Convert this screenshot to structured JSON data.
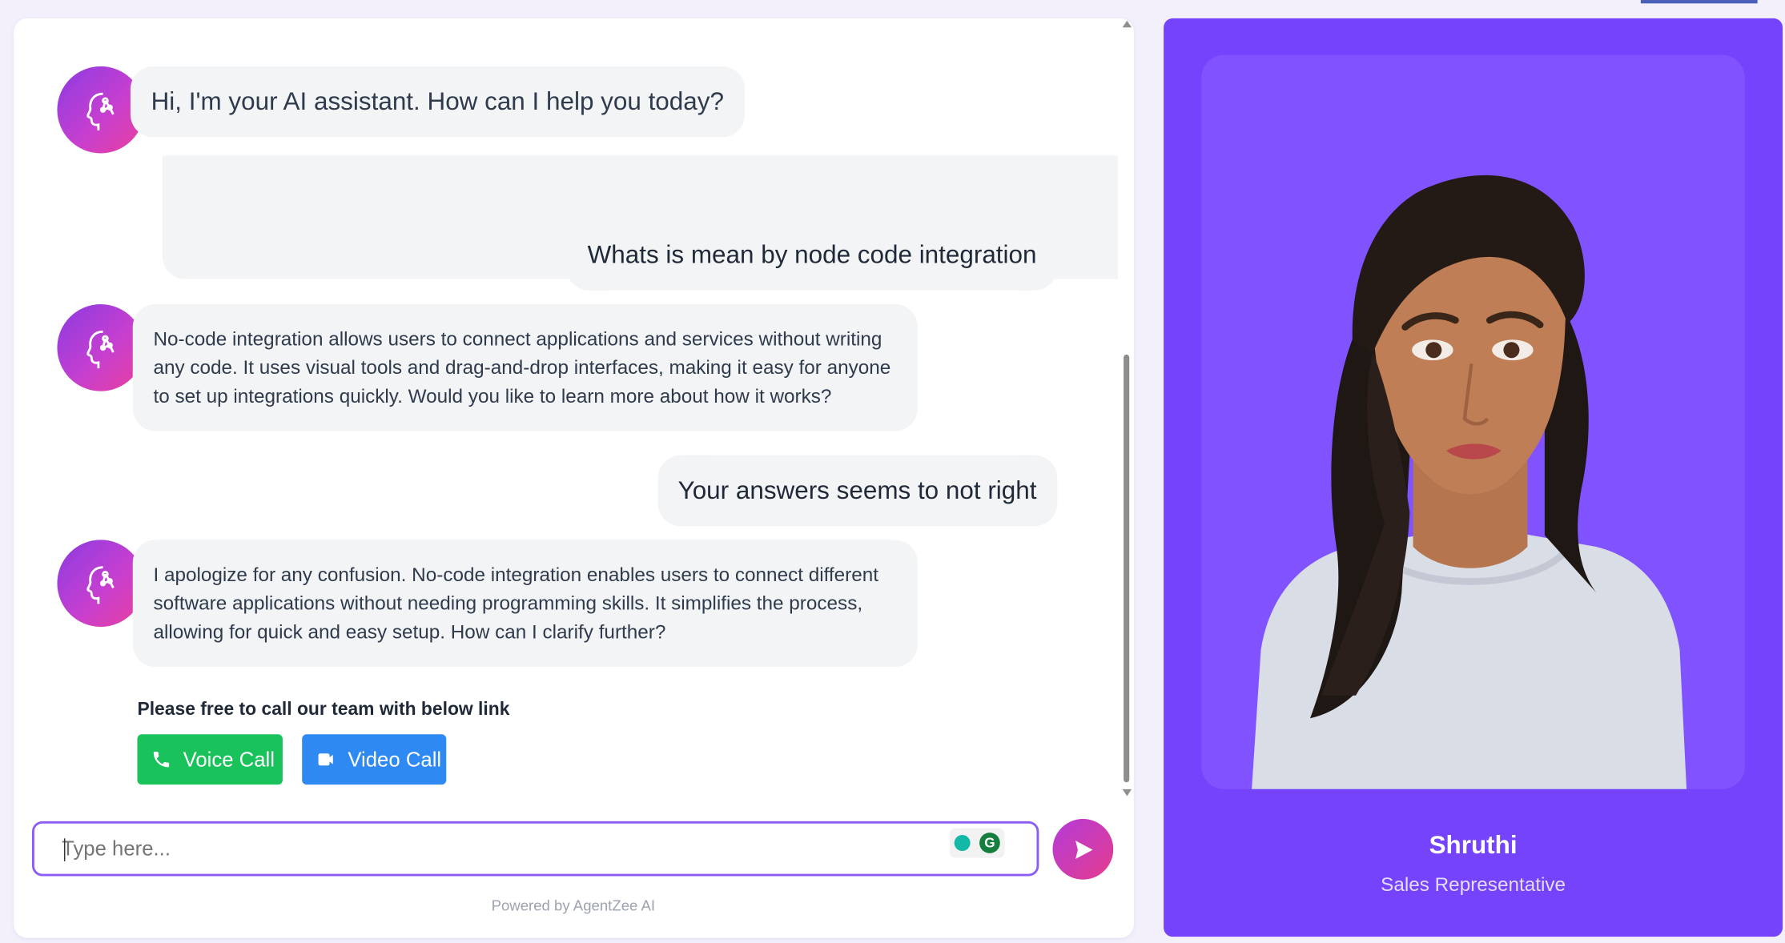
{
  "chat": {
    "messages": [
      {
        "role": "bot",
        "text": "Hi, I'm your AI assistant. How can I help you today?"
      },
      {
        "role": "user",
        "text": "Whats is mean by node code integration"
      },
      {
        "role": "bot",
        "text": "No-code integration allows users to connect applications and services without writing any code. It uses visual tools and drag-and-drop interfaces, making it easy for anyone to set up integrations quickly. Would you like to learn more about how it works?"
      },
      {
        "role": "user",
        "text": "Your answers seems to not right"
      },
      {
        "role": "bot",
        "text": "I apologize for any confusion. No-code integration enables users to connect different software applications without needing programming skills. It simplifies the process, allowing for quick and easy setup. How can I clarify further?"
      }
    ],
    "cta_text": "Please free to call our team with below link",
    "voice_call_label": "Voice Call",
    "video_call_label": "Video Call",
    "input_placeholder": "Type here...",
    "powered_by": "Powered by AgentZee AI"
  },
  "agent": {
    "name": "Shruthi",
    "role": "Sales Representative"
  },
  "colors": {
    "accent": "#7543fb",
    "voice": "#19c25a",
    "video": "#2e8af2",
    "input_border": "#8b5cf6"
  },
  "icons": [
    "bot-avatar-icon",
    "phone-icon",
    "video-camera-icon",
    "send-icon",
    "grammarly-icon",
    "lightbulb-icon"
  ]
}
